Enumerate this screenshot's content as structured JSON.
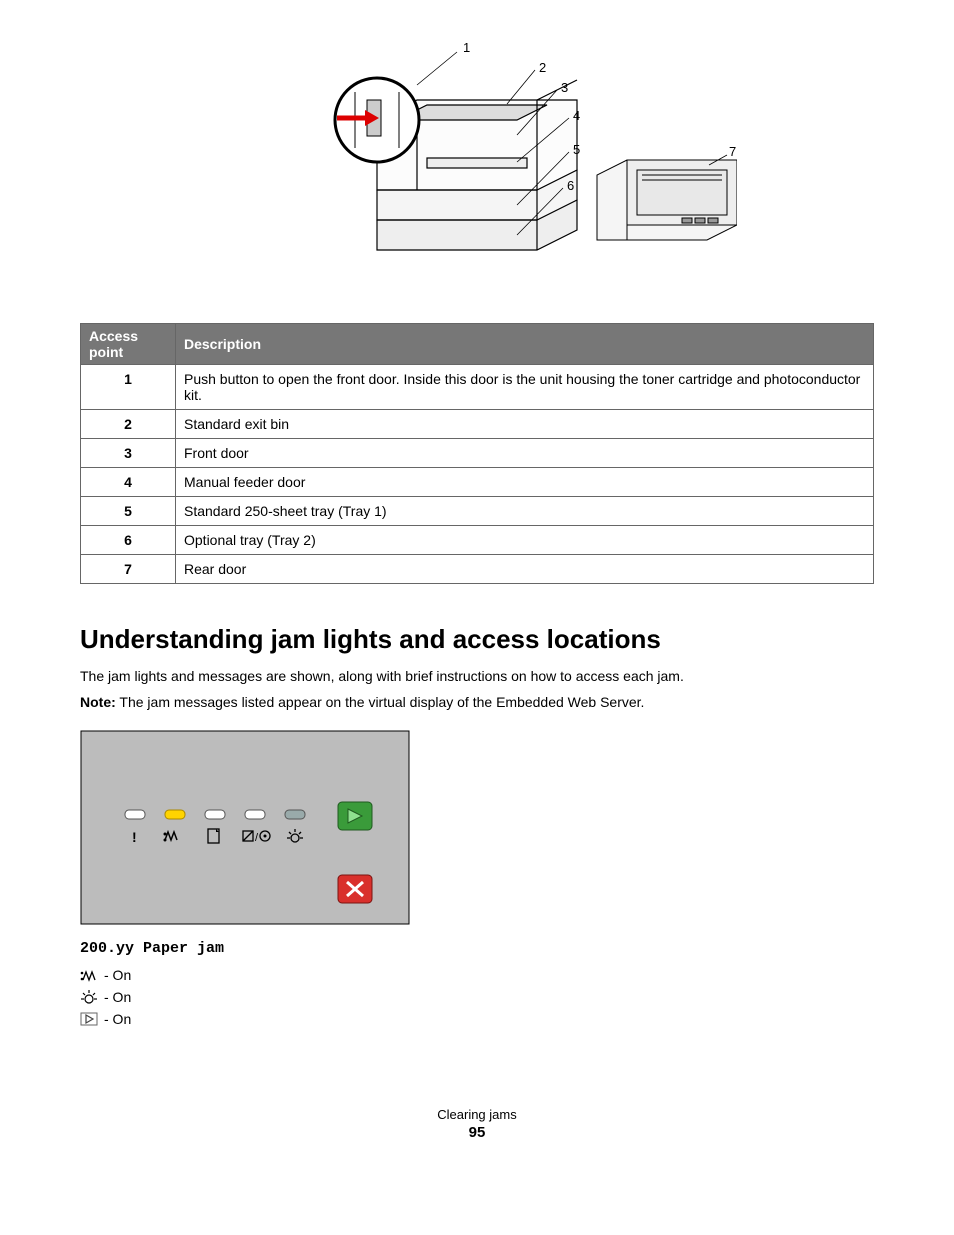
{
  "diagram": {
    "callouts": [
      "1",
      "2",
      "3",
      "4",
      "5",
      "6",
      "7"
    ]
  },
  "table": {
    "headers": {
      "col1": "Access point",
      "col2": "Description"
    },
    "rows": [
      {
        "num": "1",
        "desc": "Push button to open the front door. Inside this door is the unit housing the toner cartridge and photoconductor kit."
      },
      {
        "num": "2",
        "desc": "Standard exit bin"
      },
      {
        "num": "3",
        "desc": "Front door"
      },
      {
        "num": "4",
        "desc": "Manual feeder door"
      },
      {
        "num": "5",
        "desc": "Standard 250-sheet tray (Tray 1)"
      },
      {
        "num": "6",
        "desc": "Optional tray (Tray 2)"
      },
      {
        "num": "7",
        "desc": "Rear door"
      }
    ]
  },
  "section": {
    "heading": "Understanding jam lights and access locations",
    "intro": "The jam lights and messages are shown, along with brief instructions on how to access each jam.",
    "note_label": "Note:",
    "note_text": " The jam messages listed appear on the virtual display of the Embedded Web Server."
  },
  "jam": {
    "code": "200.yy Paper jam",
    "statuses": [
      {
        "icon": "jam-icon",
        "text": " - On"
      },
      {
        "icon": "toner-icon",
        "text": " - On"
      },
      {
        "icon": "continue-icon",
        "text": " - On"
      }
    ]
  },
  "footer": {
    "section": "Clearing jams",
    "page": "95"
  }
}
